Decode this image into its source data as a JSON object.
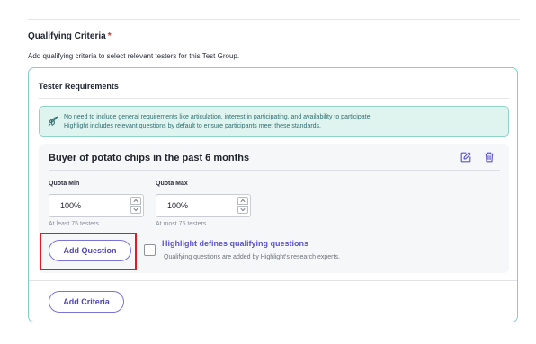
{
  "section": {
    "title": "Qualifying Criteria",
    "required_marker": "*",
    "description": "Add qualifying criteria to select relevant testers for this Test Group."
  },
  "card": {
    "title": "Tester Requirements",
    "note": {
      "icon": "rocket-icon",
      "line1": "No need to include general requirements like articulation, interest in participating, and availability to participate.",
      "line2": "Highlight includes relevant questions by default to ensure participants meet these standards."
    }
  },
  "requirement": {
    "title": "Buyer of potato chips in the past 6 months",
    "icons": {
      "edit": "edit-icon",
      "delete": "trash-icon"
    },
    "quota_min": {
      "label": "Quota Min",
      "value": "100%",
      "hint": "At least 75 testers"
    },
    "quota_max": {
      "label": "Quota Max",
      "value": "100%",
      "hint": "At most 75 testers"
    },
    "add_question_label": "Add Question",
    "highlight_option": {
      "checked": false,
      "title": "Highlight defines qualifying questions",
      "description": "Qualifying questions are added by Highlight's research experts."
    }
  },
  "add_criteria_label": "Add Criteria",
  "colors": {
    "accent": "#5b55c9",
    "card_border": "#7fd1c4",
    "note_bg": "#dff3ef",
    "required": "#d93025",
    "highlight_box": "#e01b24"
  }
}
